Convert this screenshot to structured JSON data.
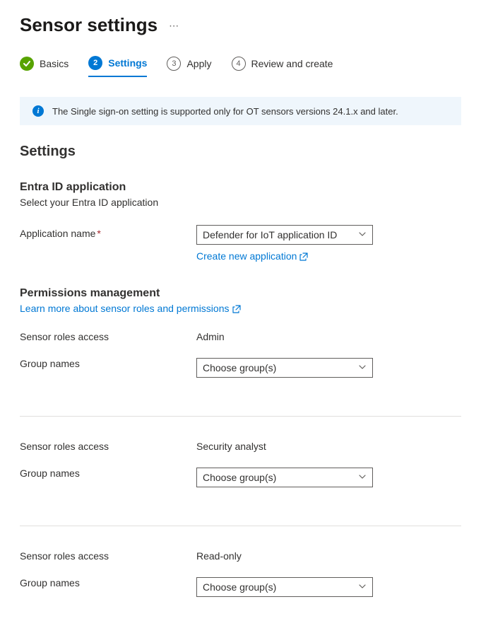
{
  "header": {
    "title": "Sensor settings"
  },
  "steps": [
    {
      "label": "Basics",
      "state": "done"
    },
    {
      "label": "Settings",
      "state": "current",
      "num": "2"
    },
    {
      "label": "Apply",
      "state": "pending",
      "num": "3"
    },
    {
      "label": "Review and create",
      "state": "pending",
      "num": "4"
    }
  ],
  "banner": {
    "text": "The Single sign-on setting is supported only for OT sensors versions 24.1.x and later."
  },
  "sections": {
    "main_heading": "Settings",
    "entra": {
      "heading": "Entra ID application",
      "desc": "Select your Entra ID application",
      "app_name_label": "Application name",
      "app_name_value": "Defender for IoT application ID",
      "create_link": "Create new application"
    },
    "perm": {
      "heading": "Permissions management",
      "learn_link": "Learn more about sensor roles and permissions",
      "roles_label": "Sensor roles access",
      "group_label": "Group names",
      "group_placeholder": "Choose group(s)",
      "roles": [
        {
          "name": "Admin"
        },
        {
          "name": "Security analyst"
        },
        {
          "name": "Read-only"
        }
      ]
    }
  }
}
